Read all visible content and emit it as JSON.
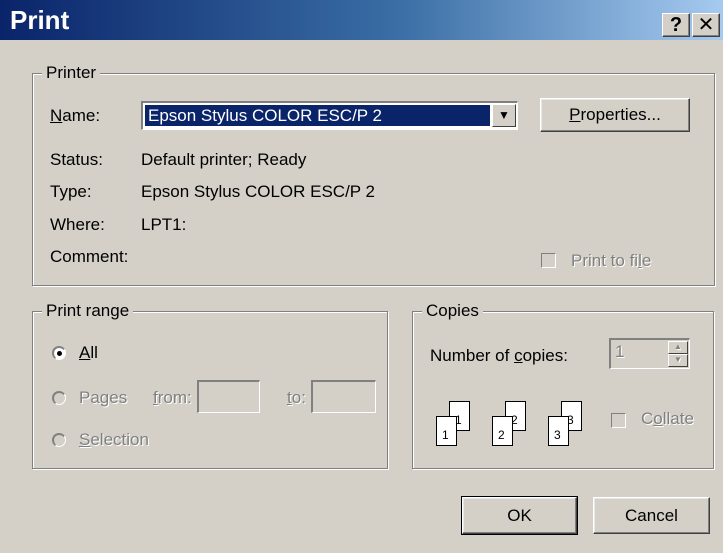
{
  "window": {
    "title": "Print",
    "help_glyph": "?",
    "close_glyph": "✕"
  },
  "printer": {
    "legend": "Printer",
    "name_label_u": "N",
    "name_label_rest": "ame:",
    "selected": "Epson Stylus COLOR ESC/P 2",
    "properties_u": "P",
    "properties_rest": "roperties...",
    "status_label": "Status:",
    "status_value": "Default printer; Ready",
    "type_label": "Type:",
    "type_value": "Epson Stylus COLOR ESC/P 2",
    "where_label": "Where:",
    "where_value": "LPT1:",
    "comment_label": "Comment:",
    "print_to_file_pre": "Print to fi",
    "print_to_file_u": "l",
    "print_to_file_post": "e"
  },
  "range": {
    "legend": "Print range",
    "all_u": "A",
    "all_rest": "ll",
    "pages_pre": "Pa",
    "pages_u": "g",
    "pages_post": "es",
    "from_u": "f",
    "from_rest": "rom:",
    "to_u": "t",
    "to_rest": "o:",
    "selection_u": "S",
    "selection_rest": "election"
  },
  "copies": {
    "legend": "Copies",
    "number_pre": "Number of ",
    "number_u": "c",
    "number_post": "opies:",
    "value": "1",
    "collate_pre": "C",
    "collate_u": "o",
    "collate_post": "llate",
    "pages": [
      "1",
      "1",
      "2",
      "2",
      "3",
      "3"
    ]
  },
  "buttons": {
    "ok": "OK",
    "cancel": "Cancel"
  }
}
